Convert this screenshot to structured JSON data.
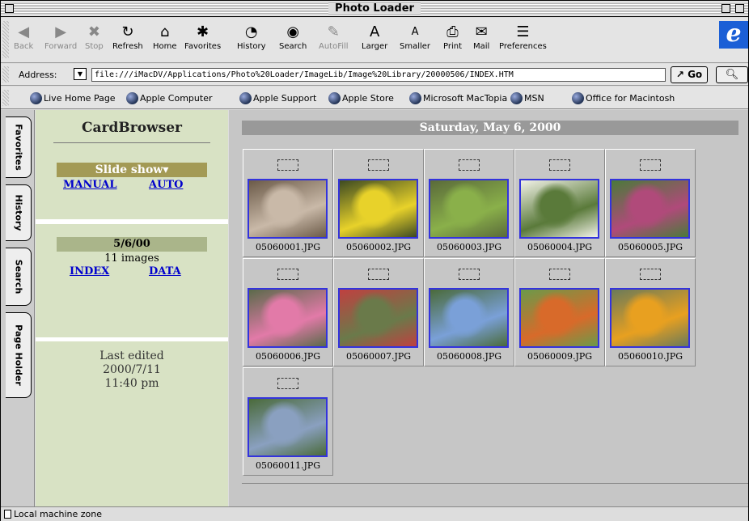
{
  "window": {
    "title": "Photo Loader"
  },
  "toolbar": {
    "buttons": [
      {
        "label": "Back",
        "icon": "◀",
        "enabled": false
      },
      {
        "label": "Forward",
        "icon": "▶",
        "enabled": false
      },
      {
        "label": "Stop",
        "icon": "✖",
        "enabled": false
      },
      {
        "label": "Refresh",
        "icon": "↻",
        "enabled": true
      },
      {
        "label": "Home",
        "icon": "⌂",
        "enabled": true
      },
      {
        "label": "Favorites",
        "icon": "✱",
        "enabled": true
      },
      {
        "label": "History",
        "icon": "◔",
        "enabled": true
      },
      {
        "label": "Search",
        "icon": "◉",
        "enabled": true
      },
      {
        "label": "AutoFill",
        "icon": "✎",
        "enabled": false
      },
      {
        "label": "Larger",
        "icon": "A",
        "enabled": true
      },
      {
        "label": "Smaller",
        "icon": "A",
        "enabled": true
      },
      {
        "label": "Print",
        "icon": "⎙",
        "enabled": true
      },
      {
        "label": "Mail",
        "icon": "✉",
        "enabled": true
      },
      {
        "label": "Preferences",
        "icon": "☰",
        "enabled": true
      }
    ]
  },
  "address": {
    "label": "Address:",
    "value": "file:///iMacDV/Applications/Photo%20Loader/ImageLib/Image%20Library/20000506/INDEX.HTM",
    "go": "Go"
  },
  "favorites": [
    "Live Home Page",
    "Apple Computer",
    "Apple Support",
    "Apple Store",
    "Microsoft MacTopia",
    "MSN",
    "Office for Macintosh"
  ],
  "tabs": [
    "Favorites",
    "History",
    "Search",
    "Page Holder"
  ],
  "left": {
    "title": "CardBrowser",
    "slideshow": "Slide show",
    "manual": "MANUAL",
    "auto": "AUTO",
    "date": "5/6/00",
    "count": "11 images",
    "index": "INDEX",
    "data": "DATA",
    "edited_label": "Last edited",
    "edited_date": "2000/7/11",
    "edited_time": "11:40 pm"
  },
  "main": {
    "date_heading": "Saturday, May 6, 2000"
  },
  "images": [
    {
      "file": "05060001.JPG",
      "colors": [
        "#c9b9a8",
        "#6b5a48"
      ]
    },
    {
      "file": "05060002.JPG",
      "colors": [
        "#e8d22a",
        "#3d4a22"
      ]
    },
    {
      "file": "05060003.JPG",
      "colors": [
        "#8ab04a",
        "#5a6a3a"
      ]
    },
    {
      "file": "05060004.JPG",
      "colors": [
        "#5a7a3a",
        "#f2f2e8"
      ]
    },
    {
      "file": "05060005.JPG",
      "colors": [
        "#b04a7a",
        "#4a7a3a"
      ]
    },
    {
      "file": "05060006.JPG",
      "colors": [
        "#e27aa8",
        "#5a6a4a"
      ]
    },
    {
      "file": "05060007.JPG",
      "colors": [
        "#6a7a4a",
        "#c04040"
      ]
    },
    {
      "file": "05060008.JPG",
      "colors": [
        "#7aa0d8",
        "#4a6a3a"
      ]
    },
    {
      "file": "05060009.JPG",
      "colors": [
        "#d86a2a",
        "#6a9a4a"
      ]
    },
    {
      "file": "05060010.JPG",
      "colors": [
        "#e8a020",
        "#6a7a5a"
      ]
    },
    {
      "file": "05060011.JPG",
      "colors": [
        "#8aa0c0",
        "#4a6a3a"
      ]
    }
  ],
  "status": {
    "text": "Local machine zone"
  }
}
